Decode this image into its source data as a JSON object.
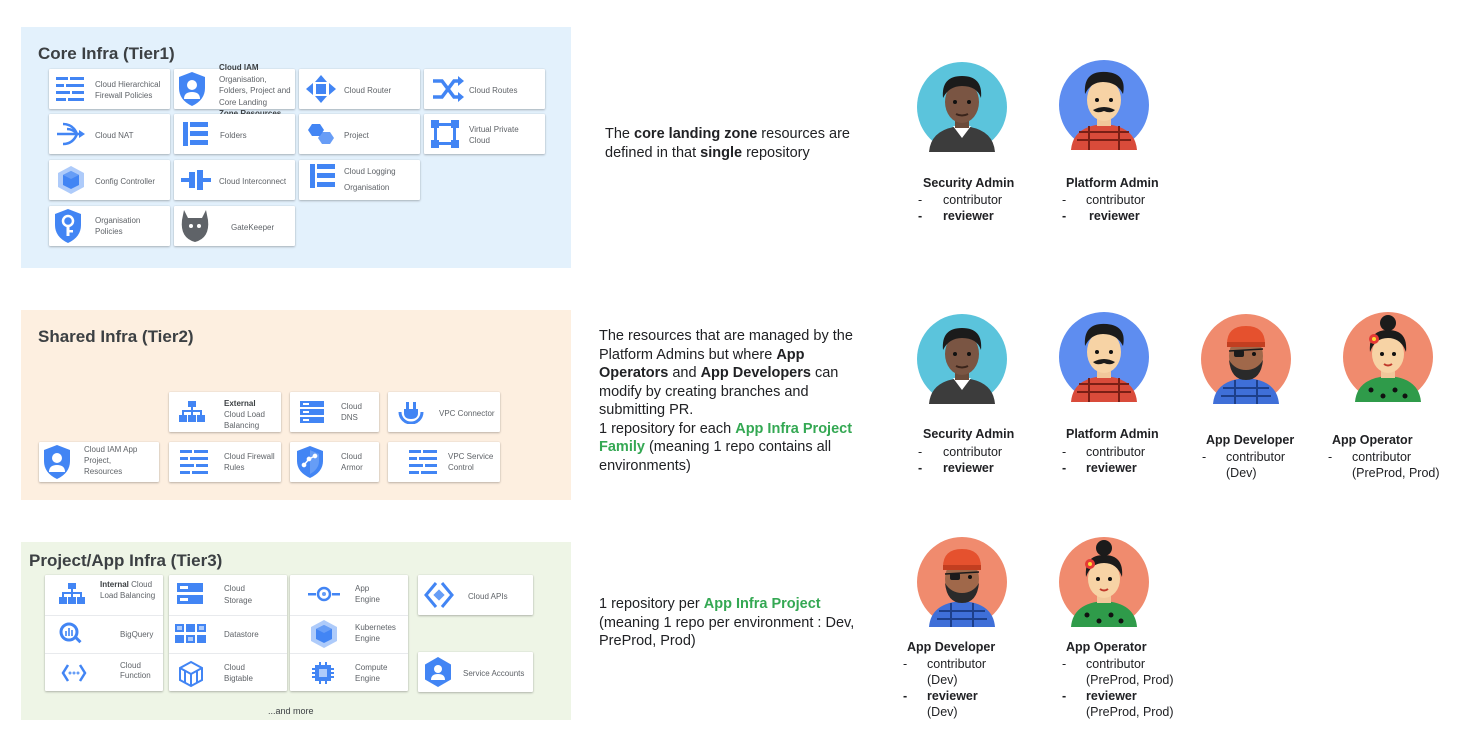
{
  "tiers": {
    "core": {
      "title": "Core Infra (Tier1)",
      "cards": [
        {
          "icon": "firewall-policies-icon",
          "label": "Cloud Hierarchical Firewall Policies"
        },
        {
          "icon": "cloud-iam-icon",
          "label_bold": "Cloud IAM",
          "label": "Organisation, Folders, Project and Core Landing",
          "label_bold2": "Zone Resources"
        },
        {
          "icon": "cloud-router-icon",
          "label": "Cloud Router"
        },
        {
          "icon": "cloud-routes-icon",
          "label": "Cloud Routes"
        },
        {
          "icon": "cloud-nat-icon",
          "label": "Cloud NAT"
        },
        {
          "icon": "folders-icon",
          "label": "Folders"
        },
        {
          "icon": "project-icon",
          "label": "Project"
        },
        {
          "icon": "vpc-icon",
          "label": "Virtual Private Cloud"
        },
        {
          "icon": "config-controller-icon",
          "label": "Config Controller"
        },
        {
          "icon": "cloud-interconnect-icon",
          "label": "Cloud Interconnect"
        },
        {
          "icon": "cloud-logging-icon",
          "label": "Cloud Logging Organisation"
        },
        {
          "icon": "organisation-policies-icon",
          "label": "Organisation Policies"
        },
        {
          "icon": "gatekeeper-icon",
          "label": "GateKeeper"
        }
      ]
    },
    "shared": {
      "title": "Shared Infra (Tier2)",
      "cards": [
        {
          "icon": "load-balancing-icon",
          "label_bold": "External",
          "label": "Cloud Load Balancing"
        },
        {
          "icon": "cloud-dns-icon",
          "label": "Cloud DNS"
        },
        {
          "icon": "vpc-connector-icon",
          "label": "VPC Connector"
        },
        {
          "icon": "cloud-iam-icon",
          "label": "Cloud IAM App Project, Resources"
        },
        {
          "icon": "firewall-rules-icon",
          "label": "Cloud Firewall Rules"
        },
        {
          "icon": "cloud-armor-icon",
          "label": "Cloud Armor"
        },
        {
          "icon": "vpc-service-control-icon",
          "label": "VPC Service Control"
        }
      ]
    },
    "project": {
      "title": "Project/App Infra (Tier3)",
      "cards": [
        {
          "icon": "load-balancing-icon",
          "label_bold": "Internal",
          "label": "Cloud Load Balancing"
        },
        {
          "icon": "bigquery-icon",
          "label": "BigQuery"
        },
        {
          "icon": "cloud-function-icon",
          "label": "Cloud Function"
        },
        {
          "icon": "cloud-storage-icon",
          "label": "Cloud Storage"
        },
        {
          "icon": "datastore-icon",
          "label": "Datastore"
        },
        {
          "icon": "cloud-bigtable-icon",
          "label": "Cloud Bigtable"
        },
        {
          "icon": "app-engine-icon",
          "label": "App Engine"
        },
        {
          "icon": "kubernetes-engine-icon",
          "label": "Kubernetes Engine"
        },
        {
          "icon": "compute-engine-icon",
          "label": "Compute Engine"
        },
        {
          "icon": "cloud-apis-icon",
          "label": "Cloud APIs"
        },
        {
          "icon": "service-accounts-icon",
          "label": "Service Accounts"
        }
      ],
      "more": "...and more"
    }
  },
  "descriptions": {
    "core": {
      "t1": "The ",
      "b1": "core landing zone",
      "t2": " resources are defined in that ",
      "b2": "single",
      "t3": " repository"
    },
    "shared": {
      "t1": "The resources that are managed by the Platform Admins but where ",
      "b1": "App Operators",
      "t2": " and ",
      "b2": "App Developers",
      "t3": " can modify by creating branches and submitting PR.",
      "t4": "1 repository for each ",
      "g1": "App Infra Project Family",
      "t5": " (meaning 1 repo contains all environments)"
    },
    "project": {
      "t1": "1 repository per ",
      "g1": "App Infra Project",
      "t2": " (meaning 1 repo per environment : Dev, PreProd, Prod)"
    }
  },
  "personas": {
    "security_admin": "Security Admin",
    "platform_admin": "Platform Admin",
    "app_developer": "App Developer",
    "app_operator": "App Operator",
    "dash": "-",
    "contributor": "contributor",
    "reviewer": "reviewer",
    "dev": "(Dev)",
    "preprod_prod": "(PreProd, Prod)"
  },
  "colors": {
    "tier1_bg": "#e3f1fc",
    "tier2_bg": "#fdefe0",
    "tier3_bg": "#eef5e6",
    "gcp_blue": "#4285f4",
    "green_text": "#34a853"
  }
}
